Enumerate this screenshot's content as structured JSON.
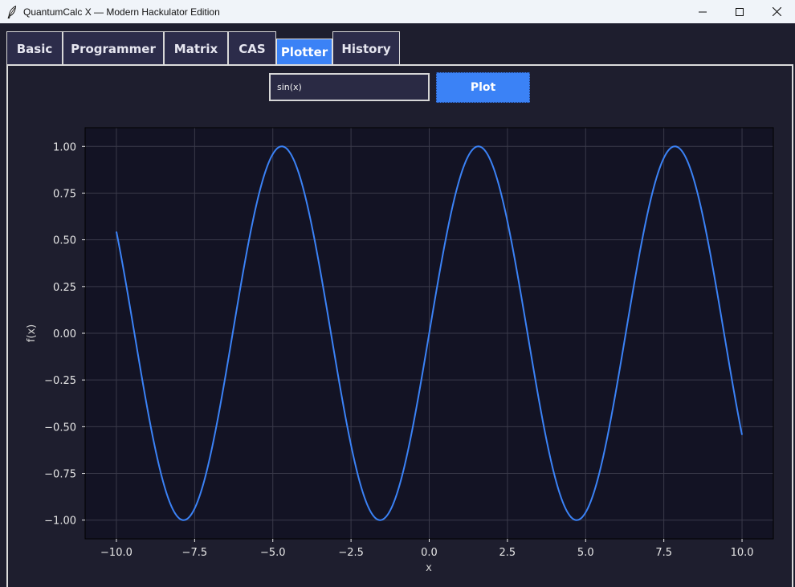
{
  "window": {
    "title": "QuantumCalc X — Modern Hackulator Edition",
    "app_icon": "feather-icon",
    "controls": [
      "minimize-icon",
      "maximize-icon",
      "close-icon"
    ]
  },
  "tabs": [
    {
      "label": "Basic",
      "active": false
    },
    {
      "label": "Programmer",
      "active": false
    },
    {
      "label": "Matrix",
      "active": false
    },
    {
      "label": "CAS",
      "active": false
    },
    {
      "label": "Plotter",
      "active": true
    },
    {
      "label": "History",
      "active": false
    }
  ],
  "plotter": {
    "expression_value": "sin(x)",
    "plot_button_label": "Plot"
  },
  "colors": {
    "accent": "#3b82f6",
    "background": "#1e1e2e",
    "plot_background": "#131324",
    "tab_background": "#2c2c4a",
    "grid": "#3a3a4a"
  },
  "chart_data": {
    "type": "line",
    "function": "sin(x)",
    "title": "",
    "xlabel": "x",
    "ylabel": "f(x)",
    "xlim": [
      -11,
      11
    ],
    "ylim": [
      -1.1,
      1.1
    ],
    "x_range": [
      -10,
      10
    ],
    "x_ticks": [
      -10.0,
      -7.5,
      -5.0,
      -2.5,
      0.0,
      2.5,
      5.0,
      7.5,
      10.0
    ],
    "x_tick_labels": [
      "−10.0",
      "−7.5",
      "−5.0",
      "−2.5",
      "0.0",
      "2.5",
      "5.0",
      "7.5",
      "10.0"
    ],
    "y_ticks": [
      1.0,
      0.75,
      0.5,
      0.25,
      0.0,
      -0.25,
      -0.5,
      -0.75,
      -1.0
    ],
    "y_tick_labels": [
      "1.00",
      "0.75",
      "0.50",
      "0.25",
      "0.00",
      "−0.25",
      "−0.50",
      "−0.75",
      "−1.00"
    ],
    "grid": true,
    "series": [
      {
        "color": "#3b82f6",
        "x": [
          -10,
          -9.5,
          -9,
          -8.5,
          -8,
          -7.5,
          -7,
          -6.5,
          -6,
          -5.5,
          -5,
          -4.5,
          -4,
          -3.5,
          -3,
          -2.5,
          -2,
          -1.5,
          -1,
          -0.5,
          0,
          0.5,
          1,
          1.5,
          2,
          2.5,
          3,
          3.5,
          4,
          4.5,
          5,
          5.5,
          6,
          6.5,
          7,
          7.5,
          8,
          8.5,
          9,
          9.5,
          10
        ],
        "values": [
          0.54,
          0.08,
          -0.41,
          -0.8,
          -0.99,
          -0.94,
          -0.66,
          -0.22,
          0.28,
          0.71,
          0.96,
          0.98,
          0.76,
          0.35,
          -0.14,
          -0.6,
          -0.91,
          -1.0,
          -0.84,
          -0.48,
          0.0,
          0.48,
          0.84,
          1.0,
          0.91,
          0.6,
          0.14,
          -0.35,
          -0.76,
          -0.98,
          -0.96,
          -0.71,
          -0.28,
          0.22,
          0.66,
          0.94,
          0.99,
          0.8,
          0.41,
          -0.08,
          -0.54
        ]
      }
    ]
  }
}
